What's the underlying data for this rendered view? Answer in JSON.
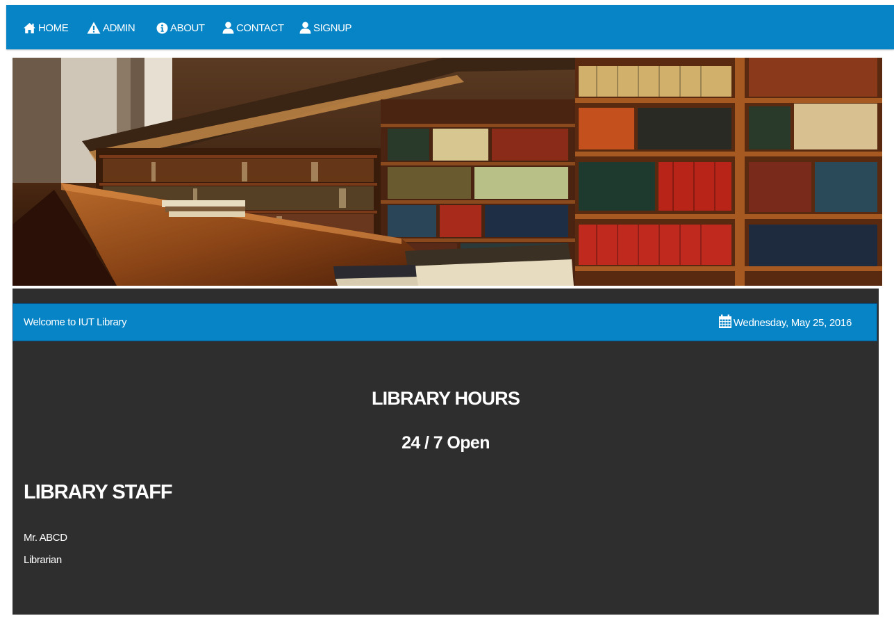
{
  "nav": {
    "items": [
      {
        "label": "HOME",
        "icon": "home-icon"
      },
      {
        "label": "ADMIN",
        "icon": "warning-icon"
      },
      {
        "label": "ABOUT",
        "icon": "info-icon"
      },
      {
        "label": "CONTACT",
        "icon": "user-icon"
      },
      {
        "label": "SIGNUP",
        "icon": "user-icon"
      }
    ]
  },
  "banner": {
    "image": "library-bookshelves-photo"
  },
  "welcome_bar": {
    "text": "Welcome to IUT Library",
    "date": "Wednesday, May 25, 2016",
    "date_icon": "calendar-icon"
  },
  "hours": {
    "title": "LIBRARY HOURS",
    "value": "24 / 7 Open"
  },
  "staff": {
    "title": "LIBRARY STAFF",
    "name": "Mr. ABCD",
    "role": "Librarian"
  },
  "colors": {
    "accent": "#0684c6",
    "panel": "#2e2e2e",
    "text": "#ffffff"
  }
}
